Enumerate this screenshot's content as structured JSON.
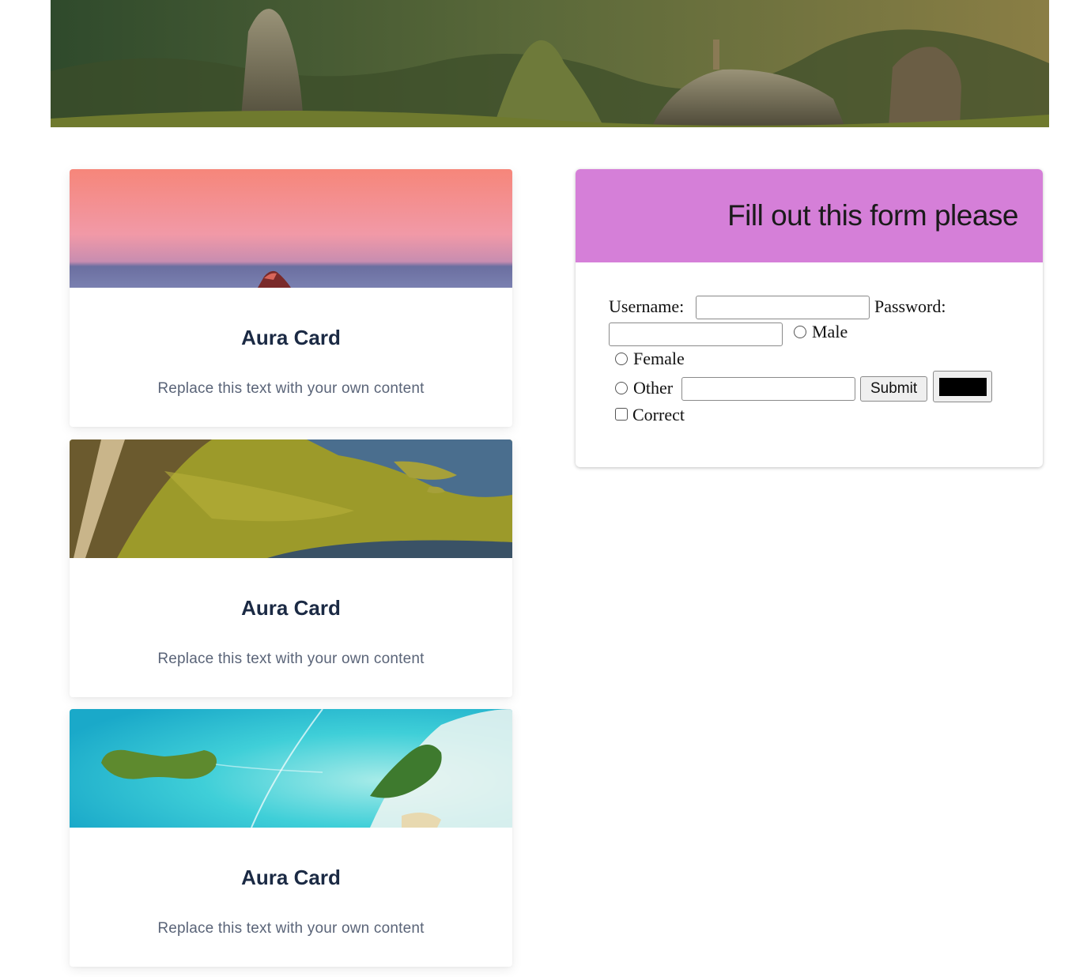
{
  "cards": [
    {
      "title": "Aura Card",
      "text": "Replace this text with your own content",
      "image": "sunset-sea-rock"
    },
    {
      "title": "Aura Card",
      "text": "Replace this text with your own content",
      "image": "aerial-river-grassland"
    },
    {
      "title": "Aura Card",
      "text": "Replace this text with your own content",
      "image": "aerial-tropical-islands"
    }
  ],
  "form": {
    "title": "Fill out this form please",
    "header_color": "#d57fd8",
    "username_label": "Username:",
    "username_value": "",
    "password_label": "Password:",
    "password_value": "",
    "gender_options": [
      "Male",
      "Female",
      "Other"
    ],
    "other_value": "",
    "submit_label": "Submit",
    "color_value": "#000000",
    "checkbox_label": "Correct"
  },
  "hero": {
    "image": "mountain-rock-pinnacles"
  }
}
